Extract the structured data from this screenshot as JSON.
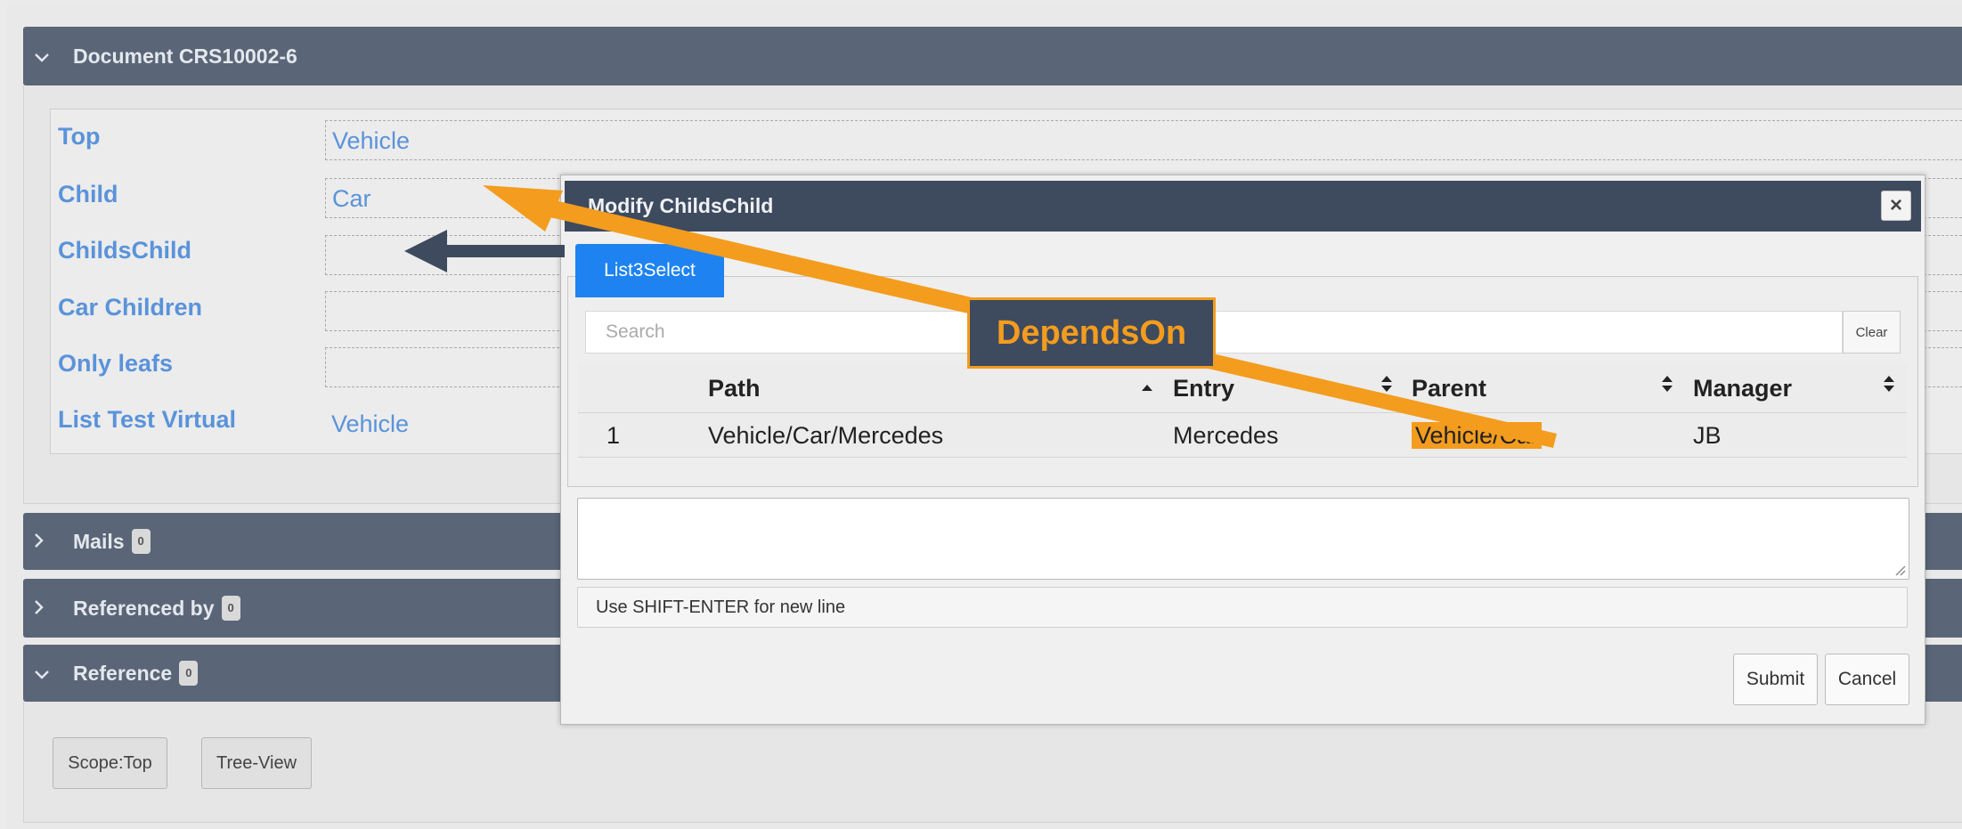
{
  "document": {
    "title": "Document CRS10002-6",
    "fields": [
      {
        "label": "Top",
        "value": "Vehicle"
      },
      {
        "label": "Child",
        "value": "Car"
      },
      {
        "label": "ChildsChild",
        "value": ""
      },
      {
        "label": "Car Children",
        "value": ""
      },
      {
        "label": "Only leafs",
        "value": ""
      },
      {
        "label": "List Test Virtual",
        "value": "Vehicle"
      }
    ]
  },
  "panels": {
    "mails": {
      "label": "Mails",
      "count": "0"
    },
    "referenced_by": {
      "label": "Referenced by",
      "count": "0"
    },
    "reference": {
      "label": "Reference",
      "count": "0"
    }
  },
  "reference_buttons": {
    "scope": "Scope:Top",
    "tree_view": "Tree-View"
  },
  "modal": {
    "title": "Modify ChildsChild",
    "close_label": "×",
    "tab_label": "List3Select",
    "search_placeholder": "Search",
    "clear_label": "Clear",
    "columns": [
      "Path",
      "Entry",
      "Parent",
      "Manager"
    ],
    "rows": [
      {
        "index": "1",
        "path": "Vehicle/Car/Mercedes",
        "entry": "Mercedes",
        "parent": "Vehicle/Car",
        "manager": "JB"
      }
    ],
    "hint": "Use SHIFT-ENTER for new line",
    "submit_label": "Submit",
    "cancel_label": "Cancel"
  },
  "annotation": {
    "label": "DependsOn",
    "color": "#f39c1e",
    "arrow_color": "#3e4a5e"
  },
  "icons": {
    "expanded": "chevron-down-icon",
    "collapsed": "chevron-right-icon",
    "sort_both": "sort-icon",
    "sort_asc": "sort-up-icon",
    "close": "close-icon"
  }
}
